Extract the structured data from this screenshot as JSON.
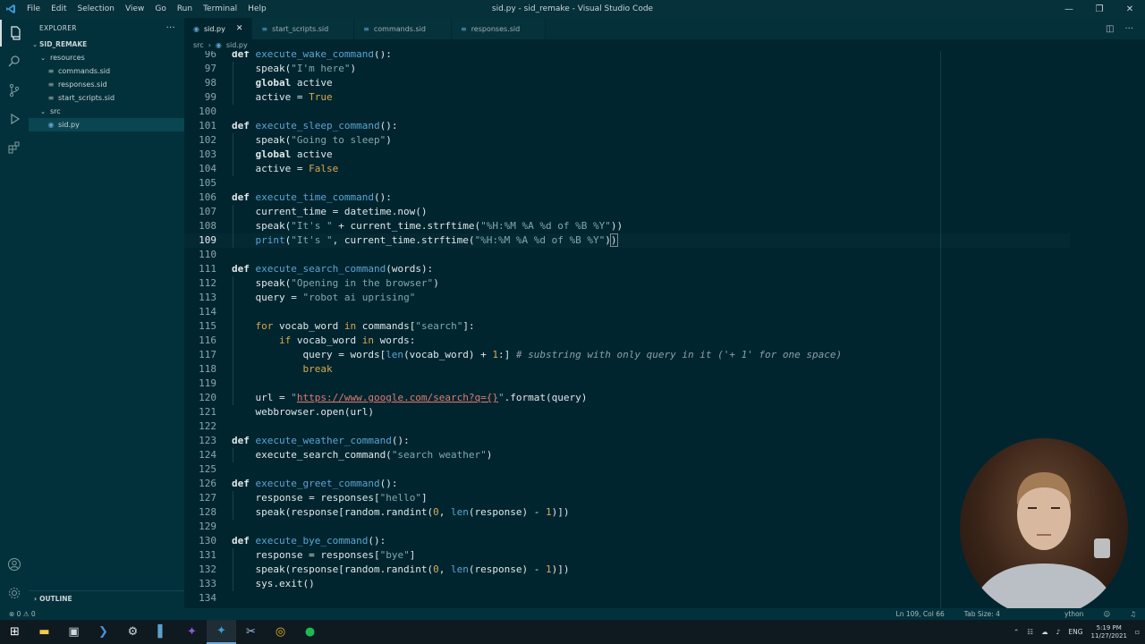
{
  "window": {
    "title": "sid.py - sid_remake - Visual Studio Code",
    "menu": [
      "File",
      "Edit",
      "Selection",
      "View",
      "Go",
      "Run",
      "Terminal",
      "Help"
    ]
  },
  "activity_bar": {
    "items": [
      "explorer-icon",
      "search-icon",
      "source-control-icon",
      "run-debug-icon",
      "extensions-icon"
    ],
    "bottom": [
      "account-icon",
      "settings-gear-icon"
    ]
  },
  "sidebar": {
    "header": "EXPLORER",
    "more": "···",
    "project": "SID_REMAKE",
    "tree": [
      {
        "label": "resources",
        "type": "folder",
        "depth": 1
      },
      {
        "label": "commands.sid",
        "type": "file",
        "depth": 2
      },
      {
        "label": "responses.sid",
        "type": "file",
        "depth": 2
      },
      {
        "label": "start_scripts.sid",
        "type": "file",
        "depth": 2
      },
      {
        "label": "src",
        "type": "folder",
        "depth": 1
      },
      {
        "label": "sid.py",
        "type": "file",
        "depth": 2,
        "selected": true
      }
    ],
    "outline": "OUTLINE"
  },
  "tabs": [
    {
      "label": "sid.py",
      "active": true
    },
    {
      "label": "start_scripts.sid",
      "active": false
    },
    {
      "label": "commands.sid",
      "active": false
    },
    {
      "label": "responses.sid",
      "active": false
    }
  ],
  "breadcrumb": {
    "folder": "src",
    "file": "sid.py"
  },
  "editor": {
    "first_line": 96,
    "current_line": 109,
    "lines": [
      [
        [
          "k",
          "def "
        ],
        [
          "fn",
          "execute_wake_command"
        ],
        [
          "",
          "():"
        ]
      ],
      [
        [
          "",
          "    speak("
        ],
        [
          "s",
          "\"I'm here\""
        ],
        [
          "",
          ")"
        ]
      ],
      [
        [
          "",
          "    "
        ],
        [
          "k",
          "global"
        ],
        [
          "",
          " active"
        ]
      ],
      [
        [
          "",
          "    active = "
        ],
        [
          "kw",
          "True"
        ]
      ],
      [],
      [
        [
          "k",
          "def "
        ],
        [
          "fn",
          "execute_sleep_command"
        ],
        [
          "",
          "():"
        ]
      ],
      [
        [
          "",
          "    speak("
        ],
        [
          "s",
          "\"Going to sleep\""
        ],
        [
          "",
          ")"
        ]
      ],
      [
        [
          "",
          "    "
        ],
        [
          "k",
          "global"
        ],
        [
          "",
          " active"
        ]
      ],
      [
        [
          "",
          "    active = "
        ],
        [
          "kw",
          "False"
        ]
      ],
      [],
      [
        [
          "k",
          "def "
        ],
        [
          "fn",
          "execute_time_command"
        ],
        [
          "",
          "():"
        ]
      ],
      [
        [
          "",
          "    current_time = datetime.now()"
        ]
      ],
      [
        [
          "",
          "    speak("
        ],
        [
          "s",
          "\"It's \""
        ],
        [
          "",
          " + current_time.strftime("
        ],
        [
          "s",
          "\"%H:%M %A %d of %B %Y\""
        ],
        [
          "",
          "))"
        ]
      ],
      [
        [
          "",
          "    "
        ],
        [
          "bi",
          "print"
        ],
        [
          "",
          "("
        ],
        [
          "s",
          "\"It's \""
        ],
        [
          "",
          ", current_time.strftime("
        ],
        [
          "s",
          "\"%H:%M %A %d of %B %Y\""
        ],
        [
          "",
          ")"
        ],
        [
          "bracket",
          ")"
        ]
      ],
      [],
      [
        [
          "k",
          "def "
        ],
        [
          "fn",
          "execute_search_command"
        ],
        [
          "",
          "(words):"
        ]
      ],
      [
        [
          "",
          "    speak("
        ],
        [
          "s",
          "\"Opening in the browser\""
        ],
        [
          "",
          ")"
        ]
      ],
      [
        [
          "",
          "    query = "
        ],
        [
          "s",
          "\"robot ai uprising\""
        ]
      ],
      [],
      [
        [
          "",
          "    "
        ],
        [
          "kw",
          "for"
        ],
        [
          "",
          " vocab_word "
        ],
        [
          "kw",
          "in"
        ],
        [
          "",
          " commands["
        ],
        [
          "s",
          "\"search\""
        ],
        [
          "",
          "]:"
        ]
      ],
      [
        [
          "",
          "        "
        ],
        [
          "kw",
          "if"
        ],
        [
          "",
          " vocab_word "
        ],
        [
          "kw",
          "in"
        ],
        [
          "",
          " words:"
        ]
      ],
      [
        [
          "",
          "            query = words["
        ],
        [
          "bi",
          "len"
        ],
        [
          "",
          "(vocab_word) + "
        ],
        [
          "n",
          "1"
        ],
        [
          "",
          ":] "
        ],
        [
          "c",
          "# substring with only query in it ('+ 1' for one space)"
        ]
      ],
      [
        [
          "",
          "            "
        ],
        [
          "kw",
          "break"
        ]
      ],
      [],
      [
        [
          "",
          "    url = "
        ],
        [
          "s",
          "\""
        ],
        [
          "u",
          "https://www.google.com/search?q={}"
        ],
        [
          "s",
          "\""
        ],
        [
          "",
          ".format(query)"
        ]
      ],
      [
        [
          "",
          "    webbrowser.open(url)"
        ]
      ],
      [],
      [
        [
          "k",
          "def "
        ],
        [
          "fn",
          "execute_weather_command"
        ],
        [
          "",
          "():"
        ]
      ],
      [
        [
          "",
          "    execute_search_command("
        ],
        [
          "s",
          "\"search weather\""
        ],
        [
          "",
          ")"
        ]
      ],
      [],
      [
        [
          "k",
          "def "
        ],
        [
          "fn",
          "execute_greet_command"
        ],
        [
          "",
          "():"
        ]
      ],
      [
        [
          "",
          "    response = responses["
        ],
        [
          "s",
          "\"hello\""
        ],
        [
          "",
          "]"
        ]
      ],
      [
        [
          "",
          "    speak(response[random.randint("
        ],
        [
          "n",
          "0"
        ],
        [
          "",
          ", "
        ],
        [
          "bi",
          "len"
        ],
        [
          "",
          "(response) - "
        ],
        [
          "n",
          "1"
        ],
        [
          "",
          ")])"
        ]
      ],
      [],
      [
        [
          "k",
          "def "
        ],
        [
          "fn",
          "execute_bye_command"
        ],
        [
          "",
          "():"
        ]
      ],
      [
        [
          "",
          "    response = responses["
        ],
        [
          "s",
          "\"bye\""
        ],
        [
          "",
          "]"
        ]
      ],
      [
        [
          "",
          "    speak(response[random.randint("
        ],
        [
          "n",
          "0"
        ],
        [
          "",
          ", "
        ],
        [
          "bi",
          "len"
        ],
        [
          "",
          "(response) - "
        ],
        [
          "n",
          "1"
        ],
        [
          "",
          ")])"
        ]
      ],
      [
        [
          "",
          "    sys.exit()"
        ]
      ],
      []
    ]
  },
  "statusbar": {
    "errors": "⊗ 0 ⚠ 0",
    "position": "Ln 109, Col 66",
    "tab_size": "Tab Size: 4",
    "language": "ython"
  },
  "taskbar": {
    "apps": [
      "windows-start-icon",
      "file-explorer-icon",
      "terminal-icon",
      "powershell-icon",
      "settings-icon",
      "notes-icon",
      "visual-studio-icon",
      "vscode-icon",
      "capture-icon",
      "chrome-icon",
      "spotify-icon"
    ],
    "language": "ENG",
    "time": "5:19 PM",
    "date": "11/27/2021"
  },
  "colors": {
    "accent": "#00252f",
    "keyword": "#d7a84e",
    "function": "#5da3d3"
  }
}
